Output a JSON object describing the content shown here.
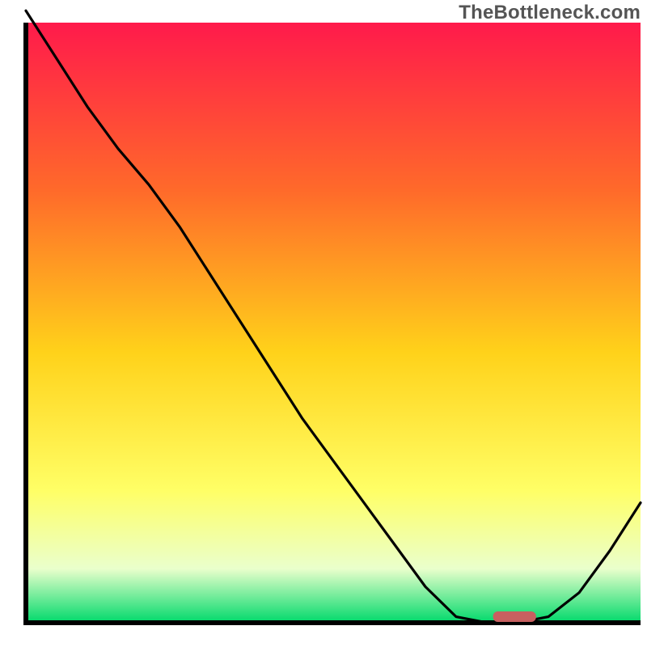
{
  "watermark": "TheBottleneck.com",
  "colors": {
    "gradient_top": "#ff1a4b",
    "gradient_mid1": "#ff6a2a",
    "gradient_mid2": "#ffd21a",
    "gradient_mid3": "#ffff66",
    "gradient_mid4": "#eaffcc",
    "gradient_bottom": "#00d96b",
    "curve": "#000000",
    "marker": "#c86060",
    "axis": "#000000"
  },
  "chart_data": {
    "type": "line",
    "title": "",
    "xlabel": "",
    "ylabel": "",
    "x": [
      0.0,
      0.05,
      0.1,
      0.15,
      0.2,
      0.25,
      0.3,
      0.35,
      0.4,
      0.45,
      0.5,
      0.55,
      0.6,
      0.65,
      0.7,
      0.75,
      0.8,
      0.85,
      0.9,
      0.95,
      1.0
    ],
    "values": [
      1.02,
      0.94,
      0.86,
      0.79,
      0.73,
      0.66,
      0.58,
      0.5,
      0.42,
      0.34,
      0.27,
      0.2,
      0.13,
      0.06,
      0.01,
      0.0,
      0.0,
      0.01,
      0.05,
      0.12,
      0.2
    ],
    "xlim": [
      0,
      1
    ],
    "ylim": [
      0,
      1
    ],
    "marker": {
      "x_start": 0.76,
      "x_end": 0.83,
      "y": 0.0
    },
    "grid": false,
    "legend": false
  }
}
